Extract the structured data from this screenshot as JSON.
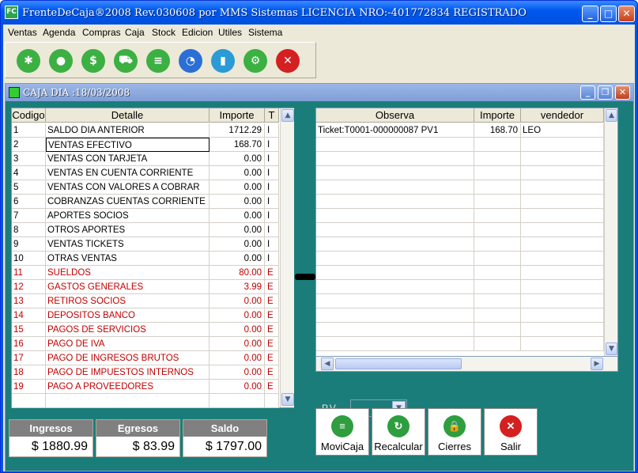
{
  "titlebar": {
    "title": "FrenteDeCaja®2008 Rev.030608 por MMS Sistemas       LICENCIA NRO:-401772834 REGISTRADO",
    "icon": "FC"
  },
  "menu": [
    "Ventas",
    "Agenda",
    "Compras",
    "Caja",
    "Stock",
    "Edicion",
    "Utiles",
    "Sistema"
  ],
  "toolbar": [
    "asterisk-icon",
    "user-icon",
    "money-icon",
    "cart-icon",
    "document-icon",
    "pie-chart-icon",
    "bar-chart-icon",
    "settings-icon",
    "close-icon"
  ],
  "child": {
    "title": "CAJA DIA :18/03/2008"
  },
  "grid1": {
    "headers": [
      "Codigo",
      "Detalle",
      "Importe",
      "T"
    ],
    "rows": [
      {
        "c": "1",
        "d": "SALDO DIA ANTERIOR",
        "i": "1712.29",
        "t": "I"
      },
      {
        "c": "2",
        "d": "VENTAS EFECTIVO",
        "i": "168.70",
        "t": "I"
      },
      {
        "c": "3",
        "d": "VENTAS CON TARJETA",
        "i": "0.00",
        "t": "I"
      },
      {
        "c": "4",
        "d": "VENTAS EN CUENTA CORRIENTE",
        "i": "0.00",
        "t": "I"
      },
      {
        "c": "5",
        "d": "VENTAS CON VALORES A COBRAR",
        "i": "0.00",
        "t": "I"
      },
      {
        "c": "6",
        "d": "COBRANZAS CUENTAS CORRIENTE",
        "i": "0.00",
        "t": "I"
      },
      {
        "c": "7",
        "d": "APORTES SOCIOS",
        "i": "0.00",
        "t": "I"
      },
      {
        "c": "8",
        "d": "OTROS APORTES",
        "i": "0.00",
        "t": "I"
      },
      {
        "c": "9",
        "d": "VENTAS TICKETS",
        "i": "0.00",
        "t": "I"
      },
      {
        "c": "10",
        "d": "OTRAS VENTAS",
        "i": "0.00",
        "t": "I"
      },
      {
        "c": "11",
        "d": "SUELDOS",
        "i": "80.00",
        "t": "E"
      },
      {
        "c": "12",
        "d": "GASTOS GENERALES",
        "i": "3.99",
        "t": "E"
      },
      {
        "c": "13",
        "d": "RETIROS SOCIOS",
        "i": "0.00",
        "t": "E"
      },
      {
        "c": "14",
        "d": "DEPOSITOS BANCO",
        "i": "0.00",
        "t": "E"
      },
      {
        "c": "15",
        "d": "PAGOS DE SERVICIOS",
        "i": "0.00",
        "t": "E"
      },
      {
        "c": "16",
        "d": "PAGO DE IVA",
        "i": "0.00",
        "t": "E"
      },
      {
        "c": "17",
        "d": "PAGO DE INGRESOS BRUTOS",
        "i": "0.00",
        "t": "E"
      },
      {
        "c": "18",
        "d": "PAGO DE IMPUESTOS INTERNOS",
        "i": "0.00",
        "t": "E"
      },
      {
        "c": "19",
        "d": "PAGO A PROVEEDORES",
        "i": "0.00",
        "t": "E"
      }
    ]
  },
  "grid2": {
    "headers": [
      "Observa",
      "Importe",
      "vendedor"
    ],
    "rows": [
      {
        "o": "Ticket:T0001-000000087 PV1",
        "i": "168.70",
        "v": "LEO"
      }
    ]
  },
  "pv": {
    "label": "P.V",
    "value": ""
  },
  "summary": [
    {
      "label": "Ingresos",
      "value": "$  1880.99"
    },
    {
      "label": "Egresos",
      "value": "$    83.99"
    },
    {
      "label": "Saldo",
      "value": "$  1797.00"
    }
  ],
  "buttons": [
    {
      "label": "MoviCaja",
      "icon": "document-icon",
      "color": "#2e9e3e"
    },
    {
      "label": "Recalcular",
      "icon": "refresh-icon",
      "color": "#2e9e3e"
    },
    {
      "label": "Cierres",
      "icon": "lock-icon",
      "color": "#2e9e3e"
    },
    {
      "label": "Salir",
      "icon": "close-icon",
      "color": "#d42020"
    }
  ],
  "colors": {
    "income": "#000000",
    "expense": "#c00000",
    "mdi_bg": "#1a7d7a"
  }
}
